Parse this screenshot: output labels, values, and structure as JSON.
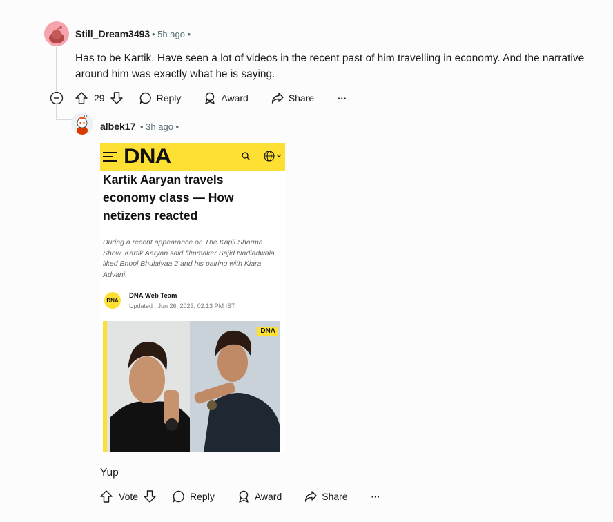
{
  "parent_comment": {
    "username": "Still_Dream3493",
    "time": "5h ago",
    "text": "Has to be Kartik. Have seen a lot of videos in the recent past of him travelling in economy. And the narrative around him was exactly what he is saying.",
    "votes": "29",
    "actions": {
      "reply": "Reply",
      "award": "Award",
      "share": "Share",
      "more": "···"
    }
  },
  "reply_comment": {
    "username": "albek17",
    "time": "3h ago",
    "text": "Yup",
    "actions": {
      "vote": "Vote",
      "reply": "Reply",
      "award": "Award",
      "share": "Share",
      "more": "···"
    }
  },
  "embed": {
    "logo": "DNA",
    "headline": "Kartik Aaryan travels economy class — How netizens reacted",
    "summary": "During a recent appearance on The Kapil Sharma Show, Kartik Aaryan said filmmaker Sajid Nadiadwala liked Bhool Bhulaiyaa 2 and his pairing with Kiara Advani.",
    "author": "DNA Web Team",
    "badge": "DNA",
    "updated": "Updated : Jun 26, 2023, 02:13 PM IST",
    "photo_watermark": "DNA"
  },
  "colors": {
    "brand_yellow": "#fde033",
    "meta_gray": "#576f76",
    "thread_line": "#d7dadc"
  }
}
